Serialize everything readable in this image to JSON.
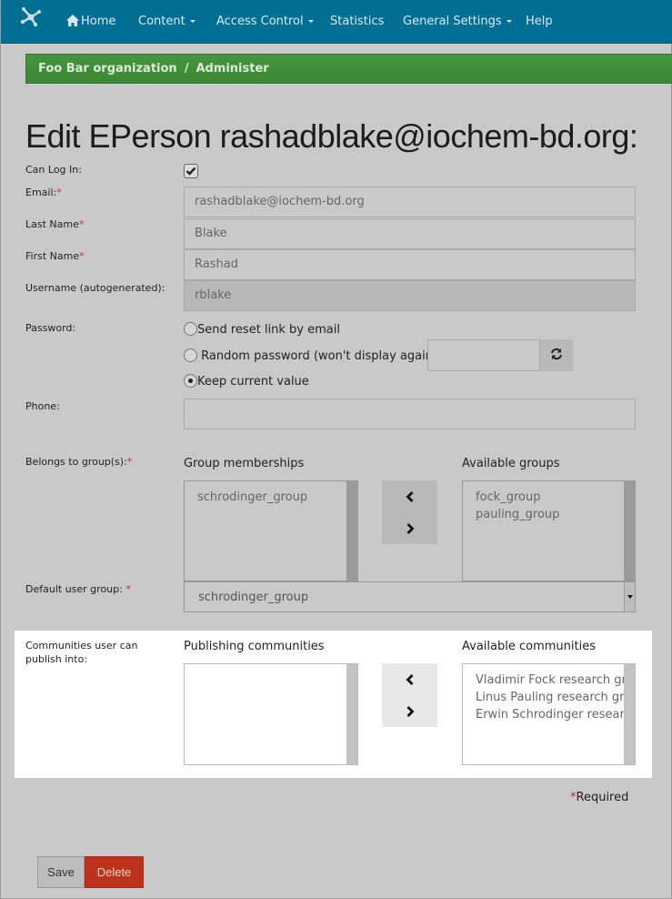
{
  "navbar": {
    "logo": "network-logo-icon",
    "items": [
      {
        "label": "Home",
        "icon": "home-icon",
        "dropdown": false
      },
      {
        "label": "Content",
        "dropdown": true
      },
      {
        "label": "Access Control",
        "dropdown": true
      },
      {
        "label": "Statistics",
        "dropdown": false
      },
      {
        "label": "General Settings",
        "dropdown": true
      },
      {
        "label": "Help",
        "dropdown": false
      }
    ]
  },
  "breadcrumb": {
    "items": [
      "Foo Bar organization",
      "Administer"
    ],
    "separator": "/"
  },
  "page": {
    "title": "Edit EPerson rashadblake@iochem-bd.org:"
  },
  "form": {
    "can_log_in": {
      "label": "Can Log In:",
      "checked": true
    },
    "email": {
      "label": "Email:",
      "required": true,
      "value": "rashadblake@iochem-bd.org"
    },
    "last_name": {
      "label": "Last Name",
      "required": true,
      "value": "Blake"
    },
    "first_name": {
      "label": "First Name",
      "required": true,
      "value": "Rashad"
    },
    "username": {
      "label": "Username (autogenerated):",
      "value": "rblake",
      "disabled": true
    },
    "password": {
      "label": "Password:",
      "options": [
        {
          "label": "Send reset link by email",
          "checked": false
        },
        {
          "label": "Random password (won't display again)",
          "checked": false
        },
        {
          "label": "Keep current value",
          "checked": true
        }
      ],
      "random_value": "",
      "regenerate_icon": "refresh-icon"
    },
    "phone": {
      "label": "Phone:",
      "value": ""
    },
    "groups": {
      "label": "Belongs to group(s):",
      "required": true,
      "memberships_header": "Group memberships",
      "memberships": [
        "schrodinger_group"
      ],
      "available_header": "Available groups",
      "available": [
        "fock_group",
        "pauling_group"
      ]
    },
    "default_group": {
      "label": "Default user group: ",
      "required": true,
      "value": "schrodinger_group"
    },
    "communities": {
      "label_line1": "Communities user can",
      "label_line2": "publish into:",
      "publishing_header": "Publishing communities",
      "publishing": [],
      "available_header": "Available communities",
      "available": [
        "Vladimir Fock research group",
        "Linus Pauling research group",
        "Erwin Schrodinger research group"
      ]
    },
    "required_marker": "*",
    "required_note": "Required"
  },
  "buttons": {
    "save": "Save",
    "delete": "Delete"
  },
  "colors": {
    "navbar": "#016f94",
    "breadcrumb": "#46953f",
    "delete": "#be311c",
    "required": "#c0302c"
  }
}
